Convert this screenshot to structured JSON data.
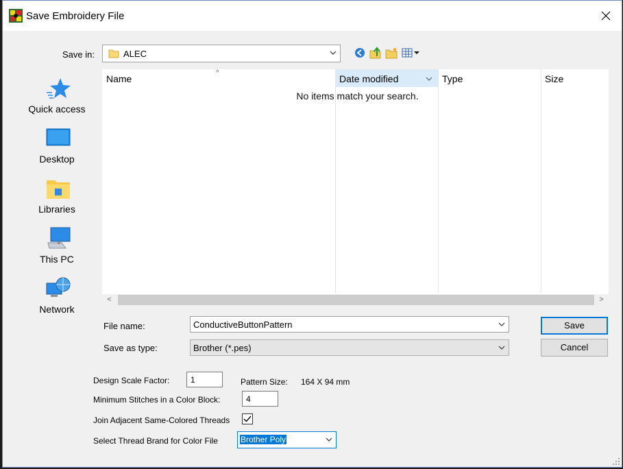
{
  "window": {
    "title": "Save Embroidery File"
  },
  "save_in": {
    "label": "Save in:",
    "value": "ALEC"
  },
  "toolbar": {
    "icons": [
      "back-icon",
      "up-folder-icon",
      "new-folder-icon",
      "view-menu-icon"
    ]
  },
  "places": [
    {
      "label": "Quick access",
      "icon": "quick-access-star-icon"
    },
    {
      "label": "Desktop",
      "icon": "desktop-icon"
    },
    {
      "label": "Libraries",
      "icon": "libraries-icon"
    },
    {
      "label": "This PC",
      "icon": "this-pc-icon"
    },
    {
      "label": "Network",
      "icon": "network-icon"
    }
  ],
  "filelist": {
    "columns": [
      "Name",
      "Date modified",
      "Type",
      "Size"
    ],
    "empty_message": "No items match your search."
  },
  "file_name": {
    "label": "File name:",
    "value": "ConductiveButtonPattern"
  },
  "save_as_type": {
    "label": "Save as type:",
    "value": "Brother (*.pes)"
  },
  "buttons": {
    "save": "Save",
    "cancel": "Cancel"
  },
  "options": {
    "scale_label": "Design Scale Factor:",
    "scale_value": "1",
    "pattern_size_label": "Pattern Size:",
    "pattern_size_value": "164 X 94 mm",
    "min_stitches_label": "Minimum Stitches in a Color Block:",
    "min_stitches_value": "4",
    "join_label": "Join Adjacent Same-Colored Threads",
    "join_checked": true,
    "thread_brand_label": "Select Thread Brand for Color File",
    "thread_brand_value": "Brother Poly"
  },
  "colors": {
    "accent": "#0078d7",
    "dialog_bg": "#f0f0f0"
  }
}
